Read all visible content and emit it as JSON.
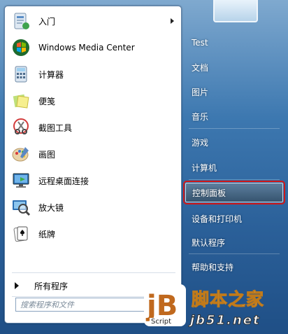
{
  "start_menu": {
    "programs": [
      {
        "label": "入门",
        "icon": "getting-started-icon",
        "has_submenu": true
      },
      {
        "label": "Windows Media Center",
        "icon": "media-center-icon",
        "has_submenu": false
      },
      {
        "label": "计算器",
        "icon": "calculator-icon",
        "has_submenu": false
      },
      {
        "label": "便笺",
        "icon": "sticky-notes-icon",
        "has_submenu": false
      },
      {
        "label": "截图工具",
        "icon": "snipping-tool-icon",
        "has_submenu": false
      },
      {
        "label": "画图",
        "icon": "paint-icon",
        "has_submenu": false
      },
      {
        "label": "远程桌面连接",
        "icon": "remote-desktop-icon",
        "has_submenu": false
      },
      {
        "label": "放大镜",
        "icon": "magnifier-icon",
        "has_submenu": false
      },
      {
        "label": "纸牌",
        "icon": "solitaire-icon",
        "has_submenu": false
      }
    ],
    "all_programs_label": "所有程序",
    "search_placeholder": "搜索程序和文件",
    "right_items": [
      {
        "label": "Test"
      },
      {
        "label": "文档"
      },
      {
        "label": "图片"
      },
      {
        "label": "音乐"
      },
      {
        "label": "游戏"
      },
      {
        "label": "计算机"
      },
      {
        "label": "控制面板",
        "highlighted": true
      },
      {
        "label": "设备和打印机"
      },
      {
        "label": "默认程序"
      },
      {
        "label": "帮助和支持"
      }
    ]
  },
  "watermark": {
    "logo_text": "jB",
    "script_label": "Script",
    "site_name": "脚本之家",
    "url": "jb51.net"
  },
  "colors": {
    "highlight_outline": "#d11919",
    "menu_blue": "#2a5f98"
  }
}
